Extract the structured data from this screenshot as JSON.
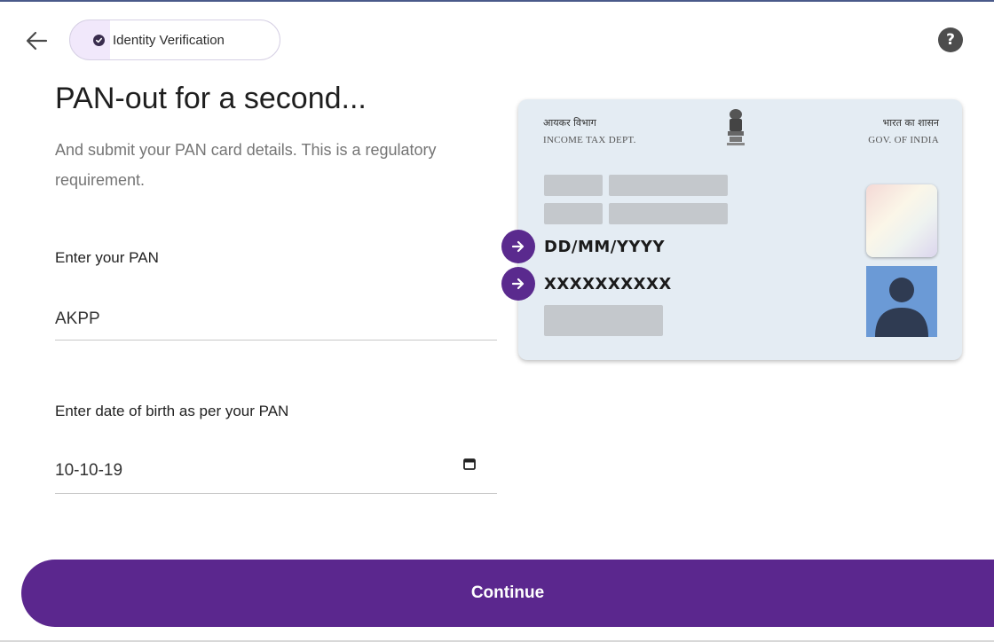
{
  "header": {
    "back_icon": "arrow-left-icon",
    "chip_label": "Identity Verification",
    "chip_icon": "check-circle-icon",
    "help_icon": "question-circle-icon",
    "help_glyph": "?"
  },
  "main": {
    "title": "PAN-out for a second...",
    "subtitle": "And submit your PAN card details. This is a regulatory requirement."
  },
  "form": {
    "pan_label": "Enter your PAN",
    "pan_value": "AKPP",
    "dob_label": "Enter date of birth as per your PAN",
    "dob_value": "10-10-19",
    "calendar_icon": "calendar-icon"
  },
  "card": {
    "hindi_left": "आयकर विभाग",
    "dept_english": "INCOME TAX DEPT.",
    "hindi_right": "भारत का शासन",
    "gov_english": "GOV. OF INDIA",
    "dob_placeholder": "DD/MM/YYYY",
    "pan_placeholder": "XXXXXXXXXX",
    "arrow_icon": "arrow-right-icon",
    "emblem": "national-emblem-icon"
  },
  "footer": {
    "continue_label": "Continue"
  },
  "colors": {
    "accent": "#5b278e",
    "card_bg": "#e4ecf3",
    "chip_bg": "#f1e8fb",
    "avatar_bg": "#6b9ad6"
  }
}
